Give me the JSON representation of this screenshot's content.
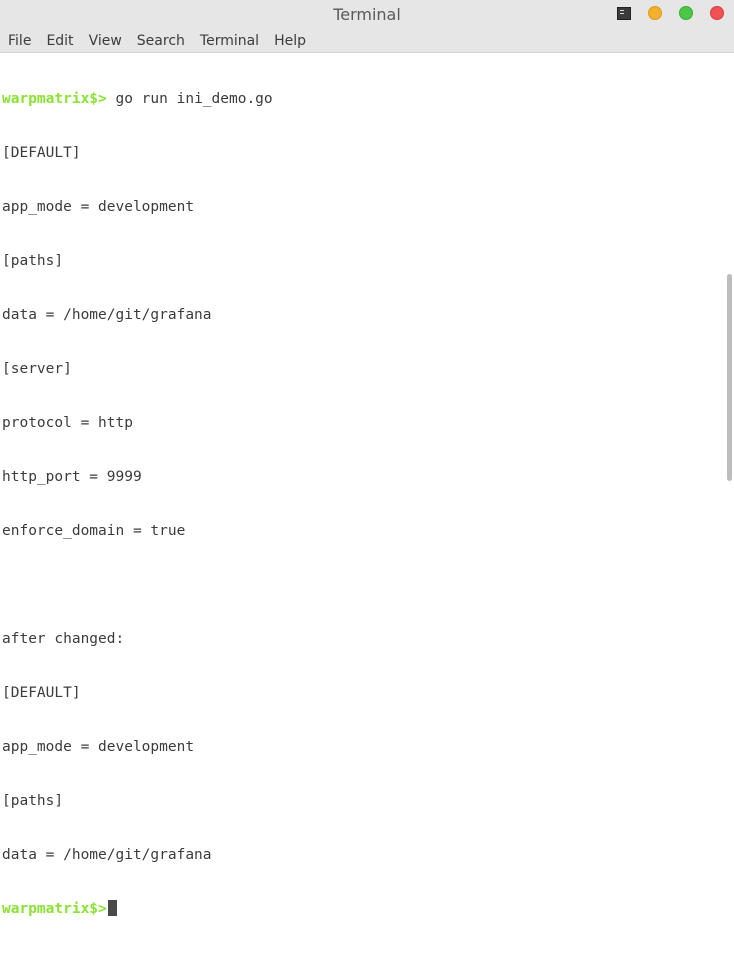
{
  "window": {
    "title": "Terminal"
  },
  "menu": [
    "File",
    "Edit",
    "View",
    "Search",
    "Terminal",
    "Help"
  ],
  "terminal": {
    "prompt": "warpmatrix$>",
    "command": " go run ini_demo.go",
    "output": [
      "[DEFAULT]",
      "app_mode = development",
      "[paths]",
      "data = /home/git/grafana",
      "[server]",
      "protocol = http",
      "http_port = 9999",
      "enforce_domain = true",
      "",
      "after changed:",
      "[DEFAULT]",
      "app_mode = development",
      "[paths]",
      "data = /home/git/grafana"
    ]
  }
}
